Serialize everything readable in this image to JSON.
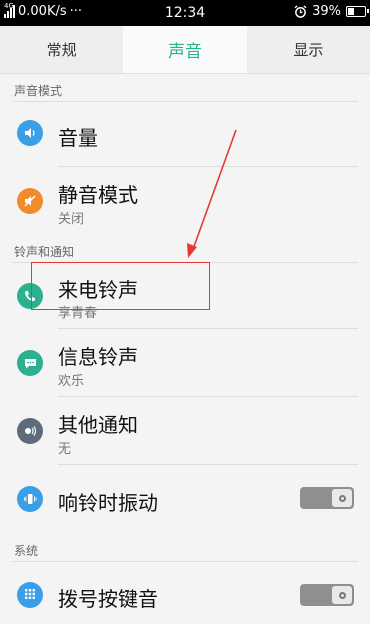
{
  "status_bar": {
    "network_label": "4G",
    "speed": "0.00K/s",
    "dots": "···",
    "time": "12:34",
    "battery": "39%",
    "battery_level": 0.39
  },
  "tabs": [
    {
      "label": "常规",
      "active": false
    },
    {
      "label": "声音",
      "active": true
    },
    {
      "label": "显示",
      "active": false
    }
  ],
  "sections": {
    "sound_mode": "声音模式",
    "ringtones": "铃声和通知",
    "system": "系统"
  },
  "items": {
    "volume": {
      "title": "音量"
    },
    "silent_mode": {
      "title": "静音模式",
      "value": "关闭"
    },
    "incoming_ringtone": {
      "title": "来电铃声",
      "value": "享青春"
    },
    "message_ringtone": {
      "title": "信息铃声",
      "value": "欢乐"
    },
    "other_notifications": {
      "title": "其他通知",
      "value": "无"
    },
    "vibrate_on_ring": {
      "title": "响铃时振动",
      "enabled": false
    },
    "dial_keypad_tone": {
      "title": "拨号按键音",
      "enabled": false
    }
  },
  "colors": {
    "accent": "#2bb18f",
    "volume_icon": "#3a9ee8",
    "silent_icon": "#f08c2a",
    "ringtone_icon": "#2bb18f",
    "message_icon": "#2bb18f",
    "notify_icon": "#5d6b7a",
    "vibrate_icon": "#3a9ee8",
    "dial_icon": "#3a9ee8",
    "annotation": "#e53935"
  }
}
